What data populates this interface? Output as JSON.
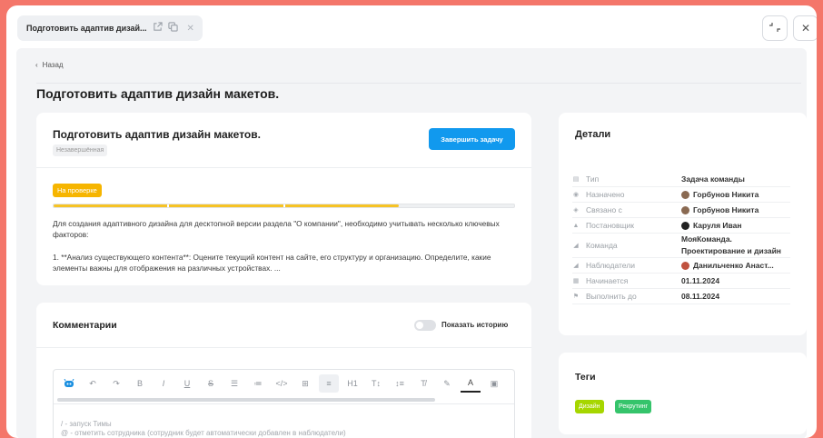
{
  "window": {
    "tab_title": "Подготовить адаптив дизай...",
    "tab_icons": [
      "external-link-icon",
      "copy-icon",
      "close-icon"
    ],
    "controls": [
      "minimize-icon",
      "close-icon"
    ]
  },
  "nav": {
    "back_label": "Назад"
  },
  "page": {
    "title": "Подготовить адаптив дизайн макетов."
  },
  "task": {
    "name": "Подготовить адаптив дизайн макетов.",
    "status": "Незавершённая",
    "complete_button": "Завершить задачу",
    "stage": "На проверке",
    "stage_color": "#f6b500",
    "progress_fraction": 0.75,
    "description": [
      "Для создания адаптивного дизайна для десктопной версии раздела \"О компании\", необходимо учитывать несколько ключевых факторов:",
      "1. **Анализ существующего контента**: Оцените текущий контент на сайте, его структуру и организацию. Определите, какие элементы важны для отображения на различных устройствах. ..."
    ]
  },
  "comments": {
    "title": "Комментарии",
    "history_toggle_label": "Показать историю",
    "history_toggle_on": false,
    "toolbar": [
      "bot-icon",
      "undo-icon",
      "redo-icon",
      "bold-icon",
      "italic-icon",
      "underline-icon",
      "strikethrough-icon",
      "bullet-list-icon",
      "numbered-list-icon",
      "code-icon",
      "table-icon",
      "align-icon",
      "heading-icon",
      "text-size-icon",
      "line-height-icon",
      "clear-format-icon",
      "highlight-icon",
      "text-color-icon",
      "image-icon"
    ],
    "toolbar_text": {
      "bold": "B",
      "italic": "I",
      "underline": "U",
      "strike": "S",
      "code": "</>",
      "heading": "H1",
      "text_color": "A"
    },
    "hint_lines": [
      "/ - запуск Тимы",
      "@ - отметить сотрудника (сотрудник будет автоматически добавлен в наблюдатели)"
    ]
  },
  "details": {
    "title": "Детали",
    "rows": [
      {
        "label": "Тип",
        "value": "Задача команды",
        "icon": "type-icon"
      },
      {
        "label": "Назначено",
        "value": "Горбунов Никита",
        "icon": "user-icon",
        "avatar": true
      },
      {
        "label": "Связано с",
        "value": "Горбунов Никита",
        "icon": "link-user-icon",
        "avatar": true
      },
      {
        "label": "Постановщик",
        "value": "Каруля Иван",
        "icon": "creator-icon",
        "avatar": true
      },
      {
        "label": "Команда",
        "value": "МояКоманда. Проектирование и дизайн",
        "icon": "team-icon"
      },
      {
        "label": "Наблюдатели",
        "value": "Данильченко Анаст...",
        "icon": "watchers-icon",
        "avatar": true
      },
      {
        "label": "Начинается",
        "value": "01.11.2024",
        "icon": "calendar-icon"
      },
      {
        "label": "Выполнить до",
        "value": "08.11.2024",
        "icon": "flag-icon"
      }
    ]
  },
  "tags": {
    "title": "Теги",
    "items": [
      {
        "label": "Дизайн",
        "color": "#a6d600"
      },
      {
        "label": "Рекрутинг",
        "color": "#35c46b"
      }
    ]
  }
}
